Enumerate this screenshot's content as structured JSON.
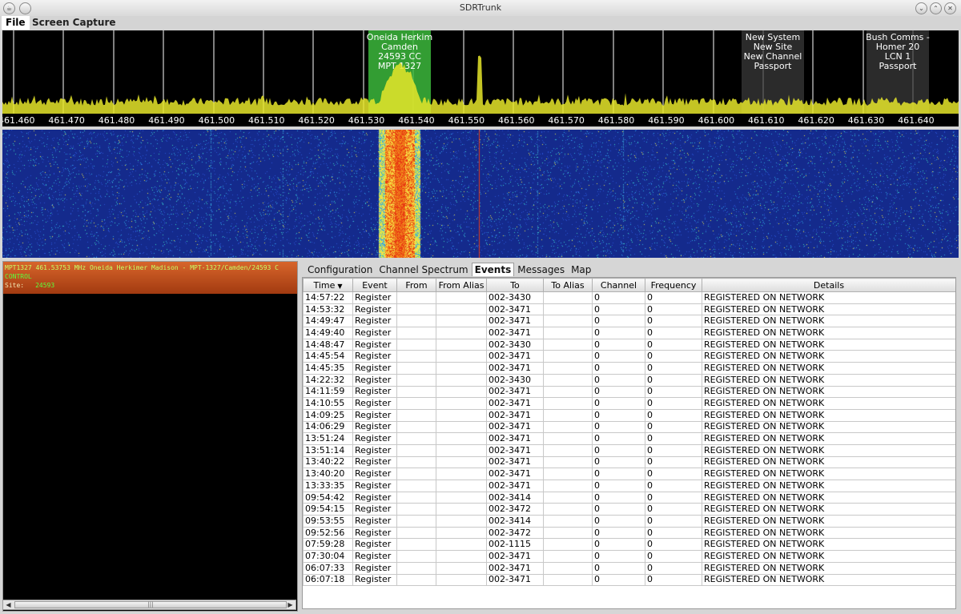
{
  "window": {
    "title": "SDRTrunk"
  },
  "menu": {
    "file": "File",
    "screen_capture": "Screen Capture"
  },
  "spectrum": {
    "ticks": [
      "461.460",
      "461.470",
      "461.480",
      "461.490",
      "461.500",
      "461.510",
      "461.520",
      "461.530",
      "461.540",
      "461.550",
      "461.560",
      "461.570",
      "461.580",
      "461.590",
      "461.600",
      "461.610",
      "461.620",
      "461.630",
      "461.640"
    ],
    "channels": [
      {
        "label": "Oneida Herkim\nCamden\n24593 CC\nMPT 1327",
        "color": "#3cb93c"
      },
      {
        "label": "New System\nNew Site\nNew Channel\nPassport",
        "color": "#3a3a3a"
      },
      {
        "label": "Bush Comms -\nHomer 20\nLCN 1\nPassport",
        "color": "#3a3a3a"
      }
    ]
  },
  "channel_panel": {
    "line1": "MPT1327 461.53753 MHz Oneida Herkimer Madison - MPT-1327/Camden/24593 C",
    "line2": "CONTROL",
    "site_label": "Site:",
    "site_value": "24593"
  },
  "tabs": [
    "Configuration",
    "Channel Spectrum",
    "Events",
    "Messages",
    "Map"
  ],
  "active_tab": "Events",
  "events": {
    "columns": [
      "Time",
      "Event",
      "From",
      "From Alias",
      "To",
      "To Alias",
      "Channel",
      "Frequency",
      "Details"
    ],
    "rows": [
      [
        "14:57:22",
        "Register",
        "",
        "",
        "002-3430",
        "",
        "0",
        "0",
        "REGISTERED ON NETWORK"
      ],
      [
        "14:53:32",
        "Register",
        "",
        "",
        "002-3471",
        "",
        "0",
        "0",
        "REGISTERED ON NETWORK"
      ],
      [
        "14:49:47",
        "Register",
        "",
        "",
        "002-3471",
        "",
        "0",
        "0",
        "REGISTERED ON NETWORK"
      ],
      [
        "14:49:40",
        "Register",
        "",
        "",
        "002-3471",
        "",
        "0",
        "0",
        "REGISTERED ON NETWORK"
      ],
      [
        "14:48:47",
        "Register",
        "",
        "",
        "002-3430",
        "",
        "0",
        "0",
        "REGISTERED ON NETWORK"
      ],
      [
        "14:45:54",
        "Register",
        "",
        "",
        "002-3471",
        "",
        "0",
        "0",
        "REGISTERED ON NETWORK"
      ],
      [
        "14:45:35",
        "Register",
        "",
        "",
        "002-3471",
        "",
        "0",
        "0",
        "REGISTERED ON NETWORK"
      ],
      [
        "14:22:32",
        "Register",
        "",
        "",
        "002-3430",
        "",
        "0",
        "0",
        "REGISTERED ON NETWORK"
      ],
      [
        "14:11:59",
        "Register",
        "",
        "",
        "002-3471",
        "",
        "0",
        "0",
        "REGISTERED ON NETWORK"
      ],
      [
        "14:10:55",
        "Register",
        "",
        "",
        "002-3471",
        "",
        "0",
        "0",
        "REGISTERED ON NETWORK"
      ],
      [
        "14:09:25",
        "Register",
        "",
        "",
        "002-3471",
        "",
        "0",
        "0",
        "REGISTERED ON NETWORK"
      ],
      [
        "14:06:29",
        "Register",
        "",
        "",
        "002-3471",
        "",
        "0",
        "0",
        "REGISTERED ON NETWORK"
      ],
      [
        "13:51:24",
        "Register",
        "",
        "",
        "002-3471",
        "",
        "0",
        "0",
        "REGISTERED ON NETWORK"
      ],
      [
        "13:51:14",
        "Register",
        "",
        "",
        "002-3471",
        "",
        "0",
        "0",
        "REGISTERED ON NETWORK"
      ],
      [
        "13:40:22",
        "Register",
        "",
        "",
        "002-3471",
        "",
        "0",
        "0",
        "REGISTERED ON NETWORK"
      ],
      [
        "13:40:20",
        "Register",
        "",
        "",
        "002-3471",
        "",
        "0",
        "0",
        "REGISTERED ON NETWORK"
      ],
      [
        "13:33:35",
        "Register",
        "",
        "",
        "002-3471",
        "",
        "0",
        "0",
        "REGISTERED ON NETWORK"
      ],
      [
        "09:54:42",
        "Register",
        "",
        "",
        "002-3414",
        "",
        "0",
        "0",
        "REGISTERED ON NETWORK"
      ],
      [
        "09:54:15",
        "Register",
        "",
        "",
        "002-3472",
        "",
        "0",
        "0",
        "REGISTERED ON NETWORK"
      ],
      [
        "09:53:55",
        "Register",
        "",
        "",
        "002-3414",
        "",
        "0",
        "0",
        "REGISTERED ON NETWORK"
      ],
      [
        "09:52:56",
        "Register",
        "",
        "",
        "002-3472",
        "",
        "0",
        "0",
        "REGISTERED ON NETWORK"
      ],
      [
        "07:59:28",
        "Register",
        "",
        "",
        "002-1115",
        "",
        "0",
        "0",
        "REGISTERED ON NETWORK"
      ],
      [
        "07:30:04",
        "Register",
        "",
        "",
        "002-3471",
        "",
        "0",
        "0",
        "REGISTERED ON NETWORK"
      ],
      [
        "06:07:33",
        "Register",
        "",
        "",
        "002-3471",
        "",
        "0",
        "0",
        "REGISTERED ON NETWORK"
      ],
      [
        "06:07:18",
        "Register",
        "",
        "",
        "002-3471",
        "",
        "0",
        "0",
        "REGISTERED ON NETWORK"
      ]
    ]
  },
  "colors": {
    "spectrum_trace": "#e6e62a",
    "control_channel": "#3cb93c",
    "waterfall_bg": "#142a8c",
    "panel_header": "#c4521e"
  }
}
